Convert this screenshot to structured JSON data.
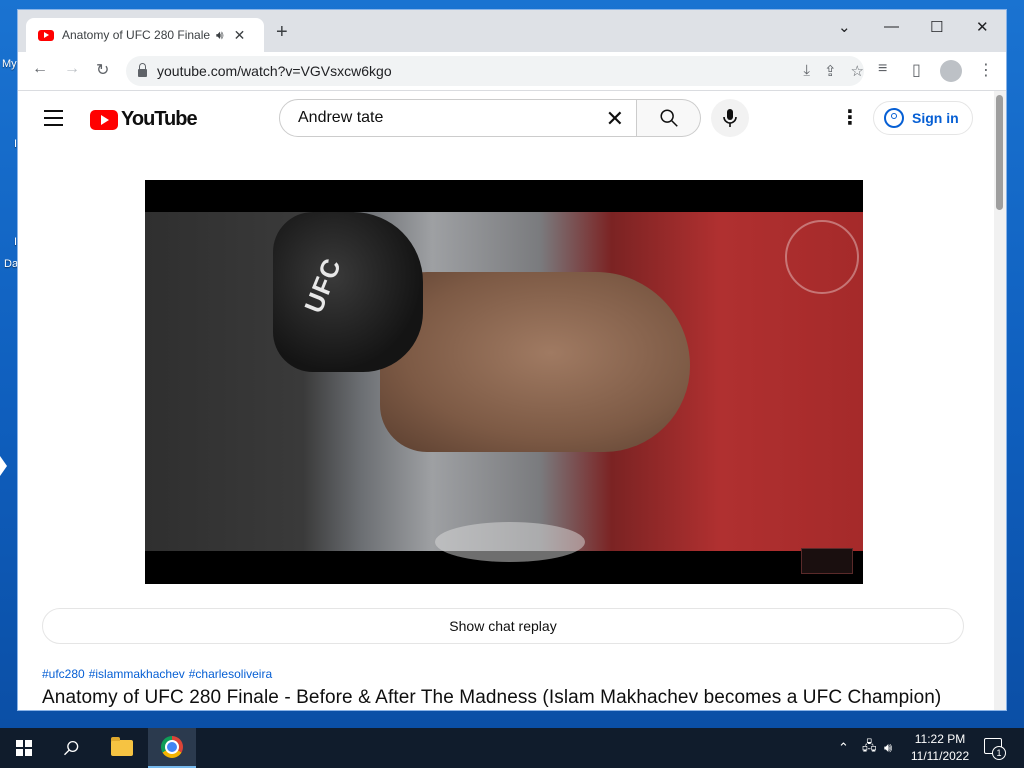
{
  "desktop": {
    "fragments": [
      "My",
      "I",
      "I",
      "Da"
    ]
  },
  "browser": {
    "tab_title": "Anatomy of UFC 280 Finale - Before & After The Madness",
    "new_tab": "+",
    "url": "youtube.com/watch?v=VGVsxcw6kgo"
  },
  "youtube": {
    "logo_text": "YouTube",
    "search_value": "Andrew tate",
    "search_placeholder": "Search",
    "sign_in": "Sign in",
    "player_overlay_text": "UFC",
    "chat_replay": "Show chat replay",
    "hashtags": [
      "#ufc280",
      "#islammakhachev",
      "#charlesoliveira"
    ],
    "video_title": "Anatomy of UFC 280 Finale - Before & After The Madness (Islam Makhachev becomes a UFC Champion)"
  },
  "taskbar": {
    "time": "11:22 PM",
    "date": "11/11/2022",
    "notification_count": "1"
  },
  "colors": {
    "youtube_red": "#ff0000",
    "link_blue": "#065fd4",
    "desktop_blue": "#1a73d1",
    "taskbar": "#101c2c"
  }
}
